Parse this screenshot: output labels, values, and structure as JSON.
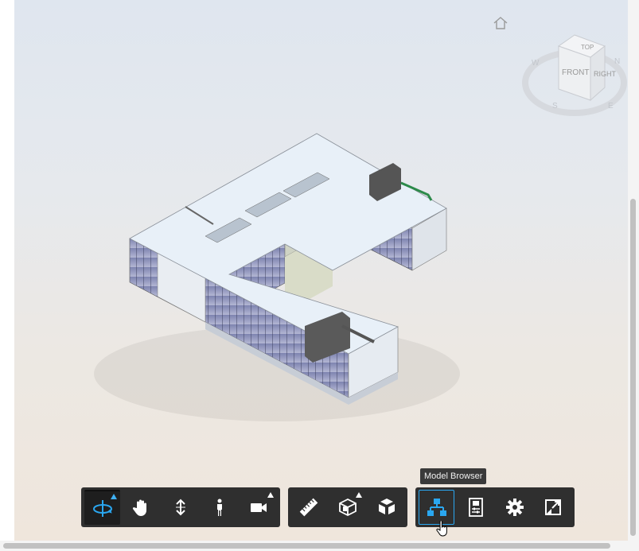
{
  "viewer": {
    "home_icon": "home-icon",
    "viewcube": {
      "top_label": "TOP",
      "front_label": "FRONT",
      "right_label": "RIGHT",
      "compass": [
        "W",
        "N",
        "S",
        "E"
      ]
    }
  },
  "toolbar": {
    "navigation": [
      {
        "name": "orbit-tool",
        "icon": "orbit-icon",
        "active": true,
        "flyout": true
      },
      {
        "name": "pan-tool",
        "icon": "hand-icon",
        "active": false,
        "flyout": false
      },
      {
        "name": "zoom-tool",
        "icon": "zoom-arrows-icon",
        "active": false,
        "flyout": false
      },
      {
        "name": "first-person-tool",
        "icon": "person-icon",
        "active": false,
        "flyout": false
      },
      {
        "name": "camera-tool",
        "icon": "camera-icon",
        "active": false,
        "flyout": true
      }
    ],
    "modeling": [
      {
        "name": "measure-tool",
        "icon": "ruler-icon"
      },
      {
        "name": "section-tool",
        "icon": "section-box-icon",
        "flyout": true
      },
      {
        "name": "explode-tool",
        "icon": "explode-cube-icon"
      }
    ],
    "settings": [
      {
        "name": "model-browser-tool",
        "icon": "model-browser-icon",
        "selected": true
      },
      {
        "name": "properties-tool",
        "icon": "properties-icon"
      },
      {
        "name": "settings-tool",
        "icon": "gear-icon"
      },
      {
        "name": "fullscreen-tool",
        "icon": "fullscreen-icon"
      }
    ]
  },
  "tooltip": {
    "text": "Model Browser"
  },
  "colors": {
    "toolbar_bg": "#2f2f2f",
    "accent": "#2aa7f0",
    "icon": "#ffffff"
  }
}
